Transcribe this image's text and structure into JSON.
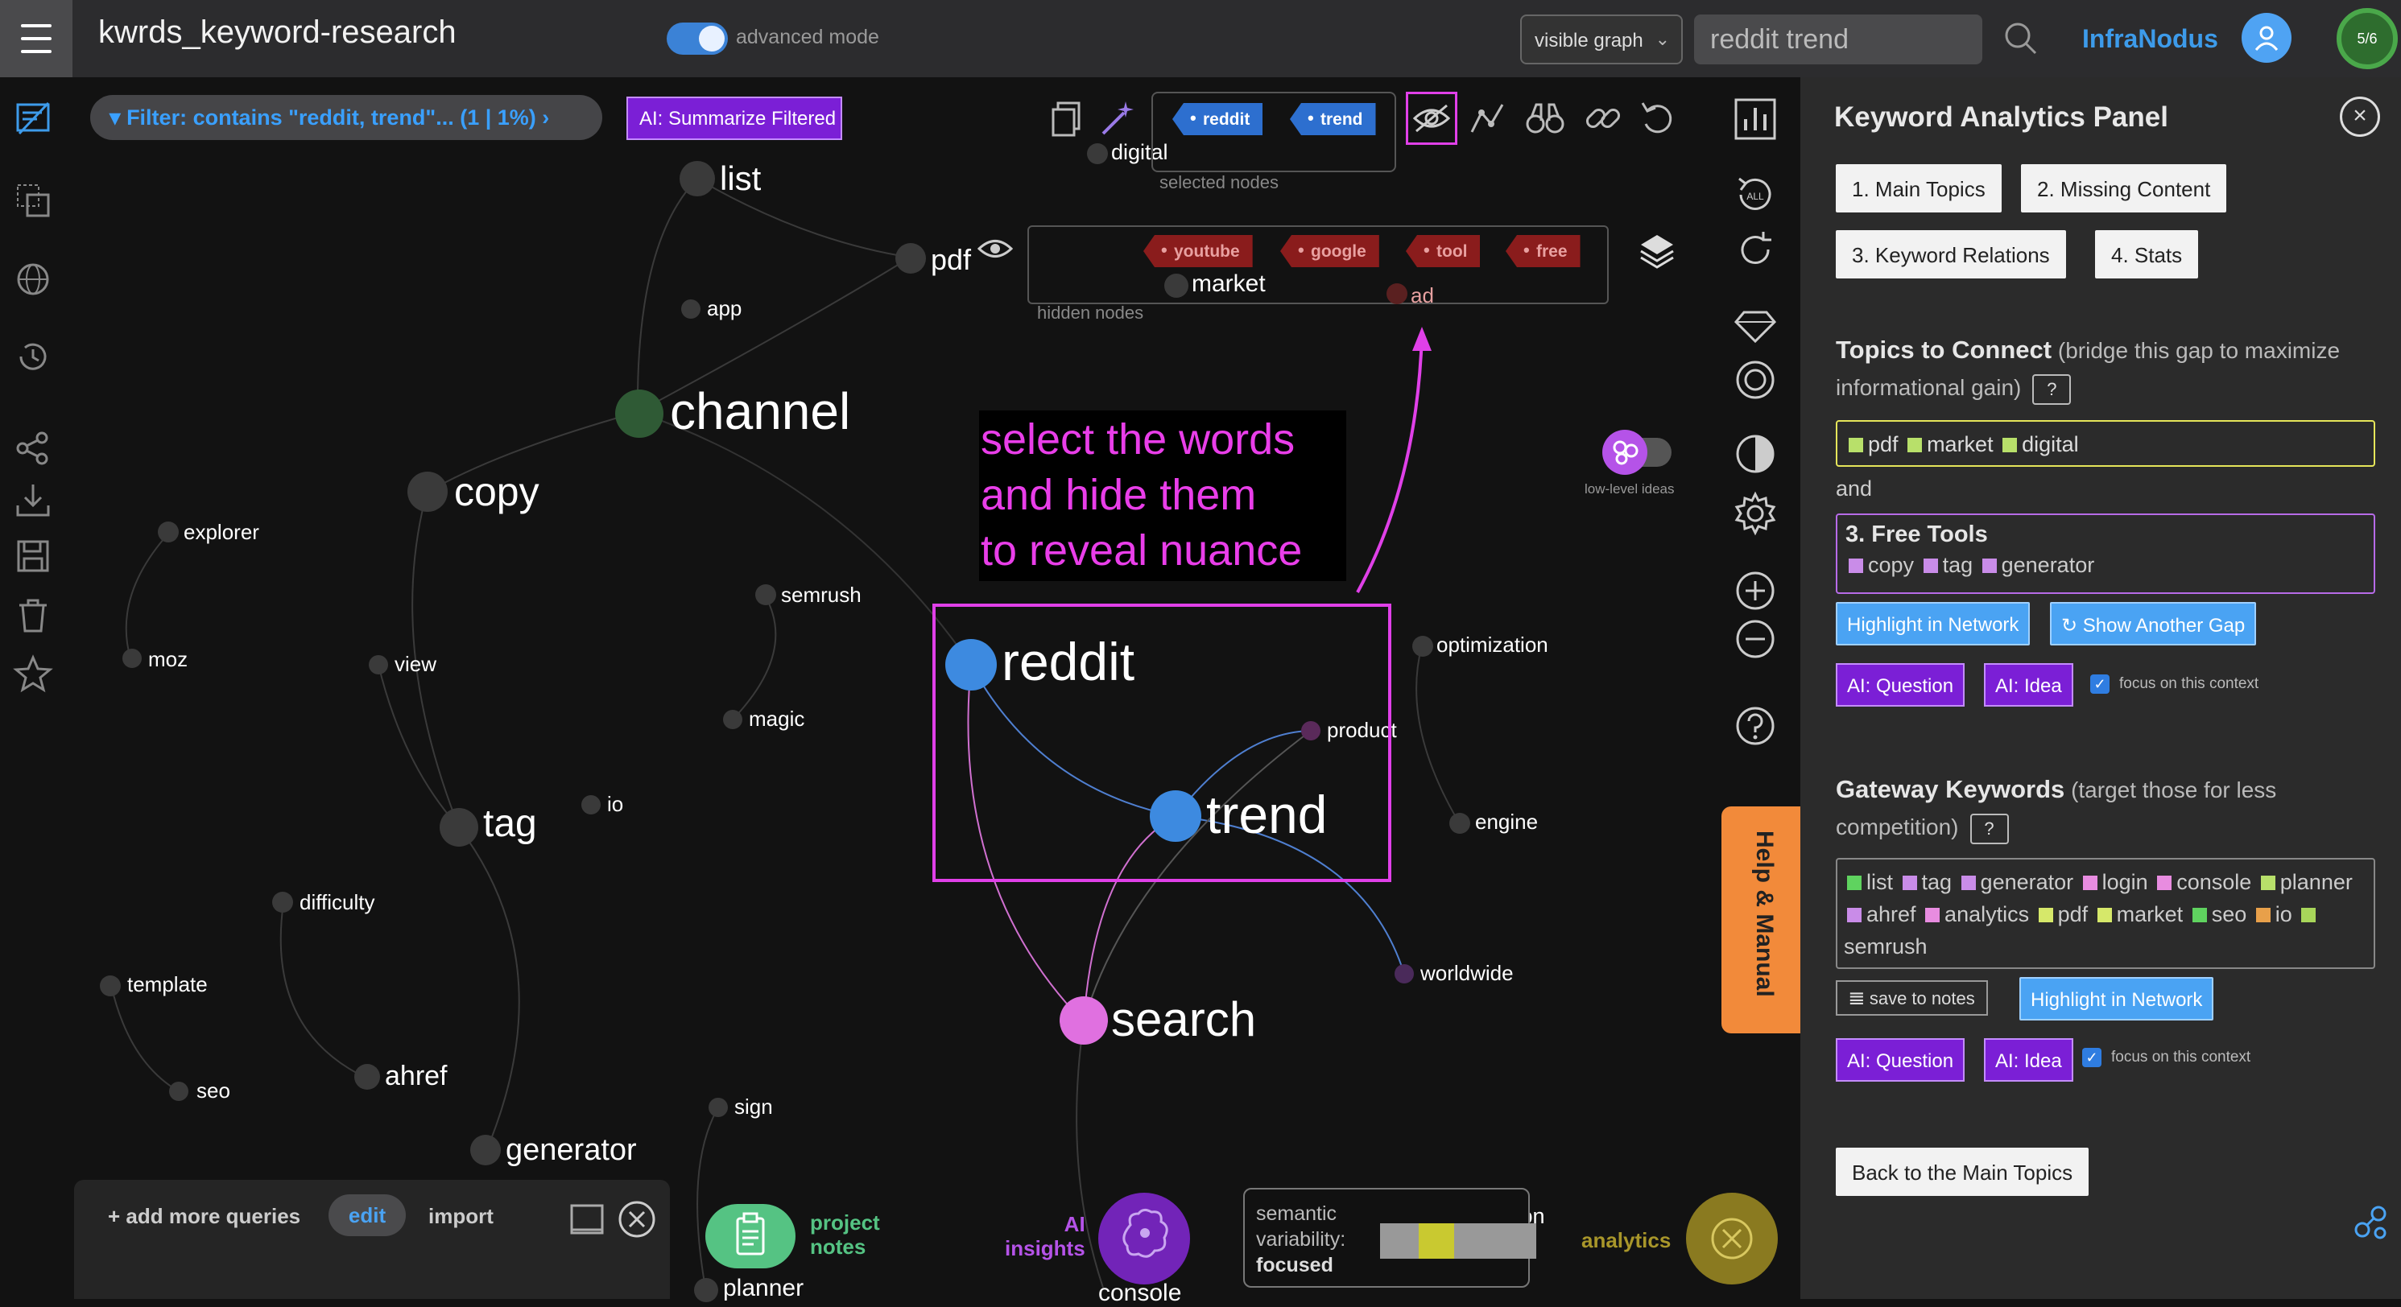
{
  "topbar": {
    "title": "kwrds_keyword-research",
    "advanced_mode_label": "advanced mode",
    "graph_select_value": "visible graph",
    "search_value": "reddit trend",
    "brand": "InfraNodus",
    "counter": "5/6"
  },
  "filter": {
    "label": "Filter: contains \"reddit, trend\"... (1 | 1%)",
    "ai_summarize": "AI: Summarize Filtered"
  },
  "selected_nodes": {
    "tags": [
      "reddit",
      "trend"
    ],
    "label": "selected nodes"
  },
  "hidden_nodes": {
    "tags": [
      "youtube",
      "google",
      "tool",
      "free"
    ],
    "label": "hidden nodes"
  },
  "annotation": {
    "line1": "select the words",
    "line2": "and hide them",
    "line3": "to reveal nuance"
  },
  "low_level_ideas_label": "low-level ideas",
  "graph_nodes": {
    "list": "list",
    "pdf": "pdf",
    "app": "app",
    "digital": "digital",
    "market": "market",
    "ad": "ad",
    "channel": "channel",
    "copy": "copy",
    "explorer": "explorer",
    "moz": "moz",
    "view": "view",
    "semrush": "semrush",
    "magic": "magic",
    "io": "io",
    "tag": "tag",
    "difficulty": "difficulty",
    "template": "template",
    "seo": "seo",
    "ahref": "ahref",
    "generator": "generator",
    "sign": "sign",
    "planner": "planner",
    "reddit": "reddit",
    "trend": "trend",
    "product": "product",
    "optimization": "optimization",
    "engine": "engine",
    "worldwide": "worldwide",
    "search": "search",
    "certification": "certification",
    "console": "console"
  },
  "help_tab": "Help & Manual",
  "panel": {
    "title": "Keyword Analytics Panel",
    "tabs": [
      "1. Main Topics",
      "2. Missing Content",
      "3. Keyword Relations",
      "4. Stats"
    ],
    "topics_heading": "Topics to Connect",
    "topics_sub": "(bridge this gap to maximize informational gain)",
    "topic_a": [
      "pdf",
      "market",
      "digital"
    ],
    "and_label": "and",
    "topic_b_title": "3. Free Tools",
    "topic_b": [
      "copy",
      "tag",
      "generator"
    ],
    "highlight_label": "Highlight in Network",
    "another_gap_label": "↻ Show Another Gap",
    "ai_question": "AI: Question",
    "ai_idea": "AI: Idea",
    "focus_label": "focus on this context",
    "gateway_heading": "Gateway Keywords",
    "gateway_sub": "(target those for less competition)",
    "gateway_keywords": [
      {
        "word": "list",
        "color": "#5fd35f"
      },
      {
        "word": "tag",
        "color": "#c98ce8"
      },
      {
        "word": "generator",
        "color": "#c98ce8"
      },
      {
        "word": "login",
        "color": "#e88ce0"
      },
      {
        "word": "console",
        "color": "#e88ce0"
      },
      {
        "word": "planner",
        "color": "#b8e06a"
      },
      {
        "word": "ahref",
        "color": "#c98ce8"
      },
      {
        "word": "analytics",
        "color": "#e88ce0"
      },
      {
        "word": "pdf",
        "color": "#d6e86a"
      },
      {
        "word": "market",
        "color": "#d6e86a"
      },
      {
        "word": "seo",
        "color": "#5fd35f"
      },
      {
        "word": "io",
        "color": "#e8a04a"
      },
      {
        "word": "semrush",
        "color": "#a8d65a"
      }
    ],
    "question_mark": "?",
    "save_notes": "save to notes",
    "back_label": "Back to the Main Topics"
  },
  "bottom": {
    "add_queries": "+ add more queries",
    "edit": "edit",
    "import": "import",
    "project_notes": "project notes",
    "ai_insights_1": "AI",
    "ai_insights_2": "insights",
    "semantic_label_1": "semantic",
    "semantic_label_2": "variability:",
    "semantic_value": "focused",
    "analytics": "analytics"
  },
  "colors": {
    "accent_blue": "#3d9bea",
    "accent_purple": "#7b1fd6",
    "highlight_magenta": "#e040e8",
    "help_orange": "#f28a3a"
  }
}
